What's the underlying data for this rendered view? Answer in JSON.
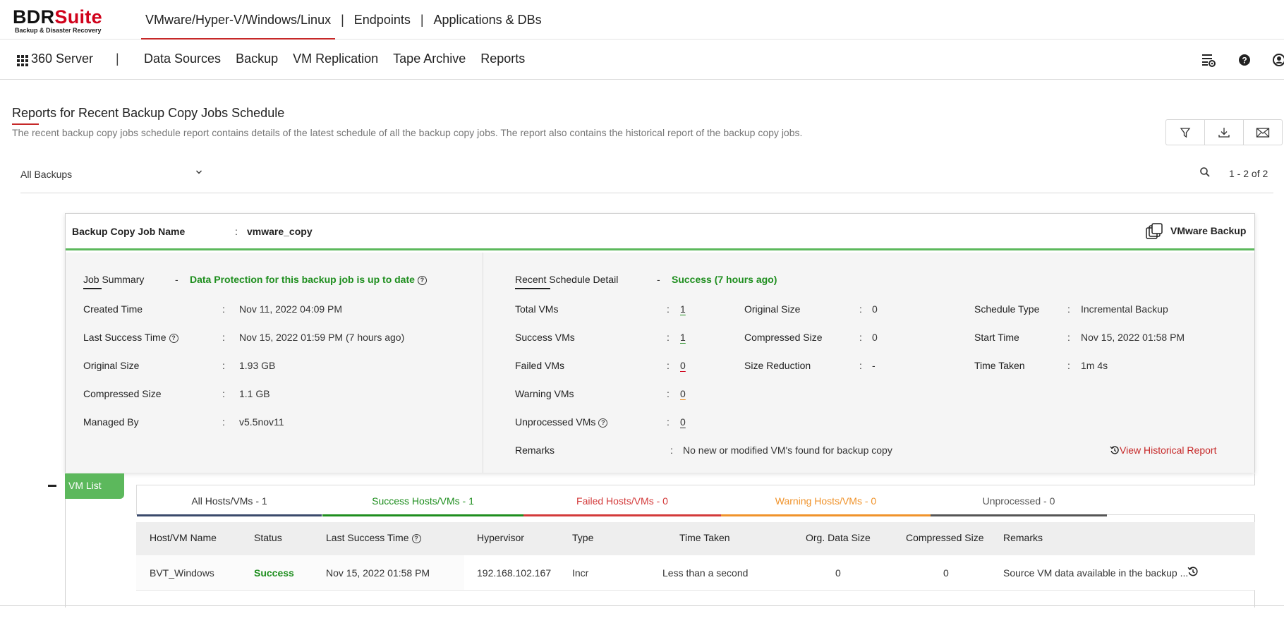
{
  "brand": {
    "name_dark": "BDR",
    "name_red": "Suite",
    "tagline": "Backup & Disaster Recovery"
  },
  "product_tabs": [
    {
      "label": "VMware/Hyper-V/Windows/Linux",
      "active": true
    },
    {
      "label": "Endpoints",
      "active": false
    },
    {
      "label": "Applications & DBs",
      "active": false
    }
  ],
  "nav": {
    "server_label": "360 Server",
    "separator": "|",
    "items": [
      "Data Sources",
      "Backup",
      "VM Replication",
      "Tape Archive",
      "Reports"
    ],
    "right_icons": [
      "task-settings-icon",
      "help-icon",
      "user-icon"
    ]
  },
  "page": {
    "title": "Reports for Recent Backup Copy Jobs Schedule",
    "description": "The recent backup copy jobs schedule report contains details of the latest schedule of all the backup copy jobs. The report also contains the historical report of the backup copy jobs.",
    "actions": [
      "filter-icon",
      "download-icon",
      "email-icon"
    ]
  },
  "filter": {
    "selected": "All Backups",
    "pagination": "1 - 2 of 2"
  },
  "job": {
    "name_label": "Backup Copy Job Name",
    "name_value": "vmware_copy",
    "type_label": "VMware Backup",
    "summary": {
      "title": "Job Summary",
      "dash": "-",
      "status": "Data Protection for this backup job is up to date",
      "rows": [
        {
          "label": "Created Time",
          "value": "Nov 11, 2022 04:09 PM",
          "help": false
        },
        {
          "label": "Last Success Time",
          "value": "Nov 15, 2022 01:59 PM (7 hours ago)",
          "help": true
        },
        {
          "label": "Original Size",
          "value": "1.93 GB",
          "help": false
        },
        {
          "label": "Compressed Size",
          "value": "1.1 GB",
          "help": false
        },
        {
          "label": "Managed By",
          "value": "v5.5nov11",
          "help": false
        }
      ]
    },
    "schedule": {
      "title": "Recent Schedule Detail",
      "dash": "-",
      "status": "Success",
      "status_time": "(7 hours ago)",
      "vm_counts": [
        {
          "label": "Total VMs",
          "value": "1",
          "help": false
        },
        {
          "label": "Success VMs",
          "value": "1",
          "help": false
        },
        {
          "label": "Failed VMs",
          "value": "0",
          "help": false
        },
        {
          "label": "Warning VMs",
          "value": "0",
          "help": false
        },
        {
          "label": "Unprocessed VMs",
          "value": "0",
          "help": true
        }
      ],
      "sizes": [
        {
          "label": "Original Size",
          "value": "0"
        },
        {
          "label": "Compressed Size",
          "value": "0"
        },
        {
          "label": "Size Reduction",
          "value": "-"
        }
      ],
      "details": [
        {
          "label": "Schedule Type",
          "value": "Incremental Backup"
        },
        {
          "label": "Start Time",
          "value": "Nov 15, 2022 01:58 PM"
        },
        {
          "label": "Time Taken",
          "value": "1m 4s"
        }
      ],
      "remarks_label": "Remarks",
      "remarks_value": "No new or modified VM's found for backup copy",
      "history_link": "View Historical Report"
    }
  },
  "vm_list": {
    "tag": "VM List",
    "tabs": [
      {
        "label": "All Hosts/VMs",
        "count": "1",
        "color": "#3a4a6b"
      },
      {
        "label": "Success Hosts/VMs",
        "count": "1",
        "color": "#1e8e1e"
      },
      {
        "label": "Failed Hosts/VMs",
        "count": "0",
        "color": "#d33a3a"
      },
      {
        "label": "Warning Hosts/VMs",
        "count": "0",
        "color": "#f0932b"
      },
      {
        "label": "Unprocessed",
        "count": "0",
        "color": "#555555"
      }
    ],
    "columns": [
      "Host/VM Name",
      "Status",
      "Last Success Time",
      "Hypervisor",
      "Type",
      "Time Taken",
      "Org. Data Size",
      "Compressed Size",
      "Remarks"
    ],
    "rows": [
      {
        "name": "BVT_Windows",
        "status": "Success",
        "last_success": "Nov 15, 2022 01:58 PM",
        "hypervisor": "192.168.102.167",
        "type": "Incr",
        "time_taken": "Less than a second",
        "org_size": "0",
        "compressed": "0",
        "remarks": "Source VM data available in the backup ..."
      }
    ]
  },
  "colors": {
    "accent_red": "#c62828",
    "success_green": "#1e8e1e",
    "card_green": "#5cb85c"
  }
}
